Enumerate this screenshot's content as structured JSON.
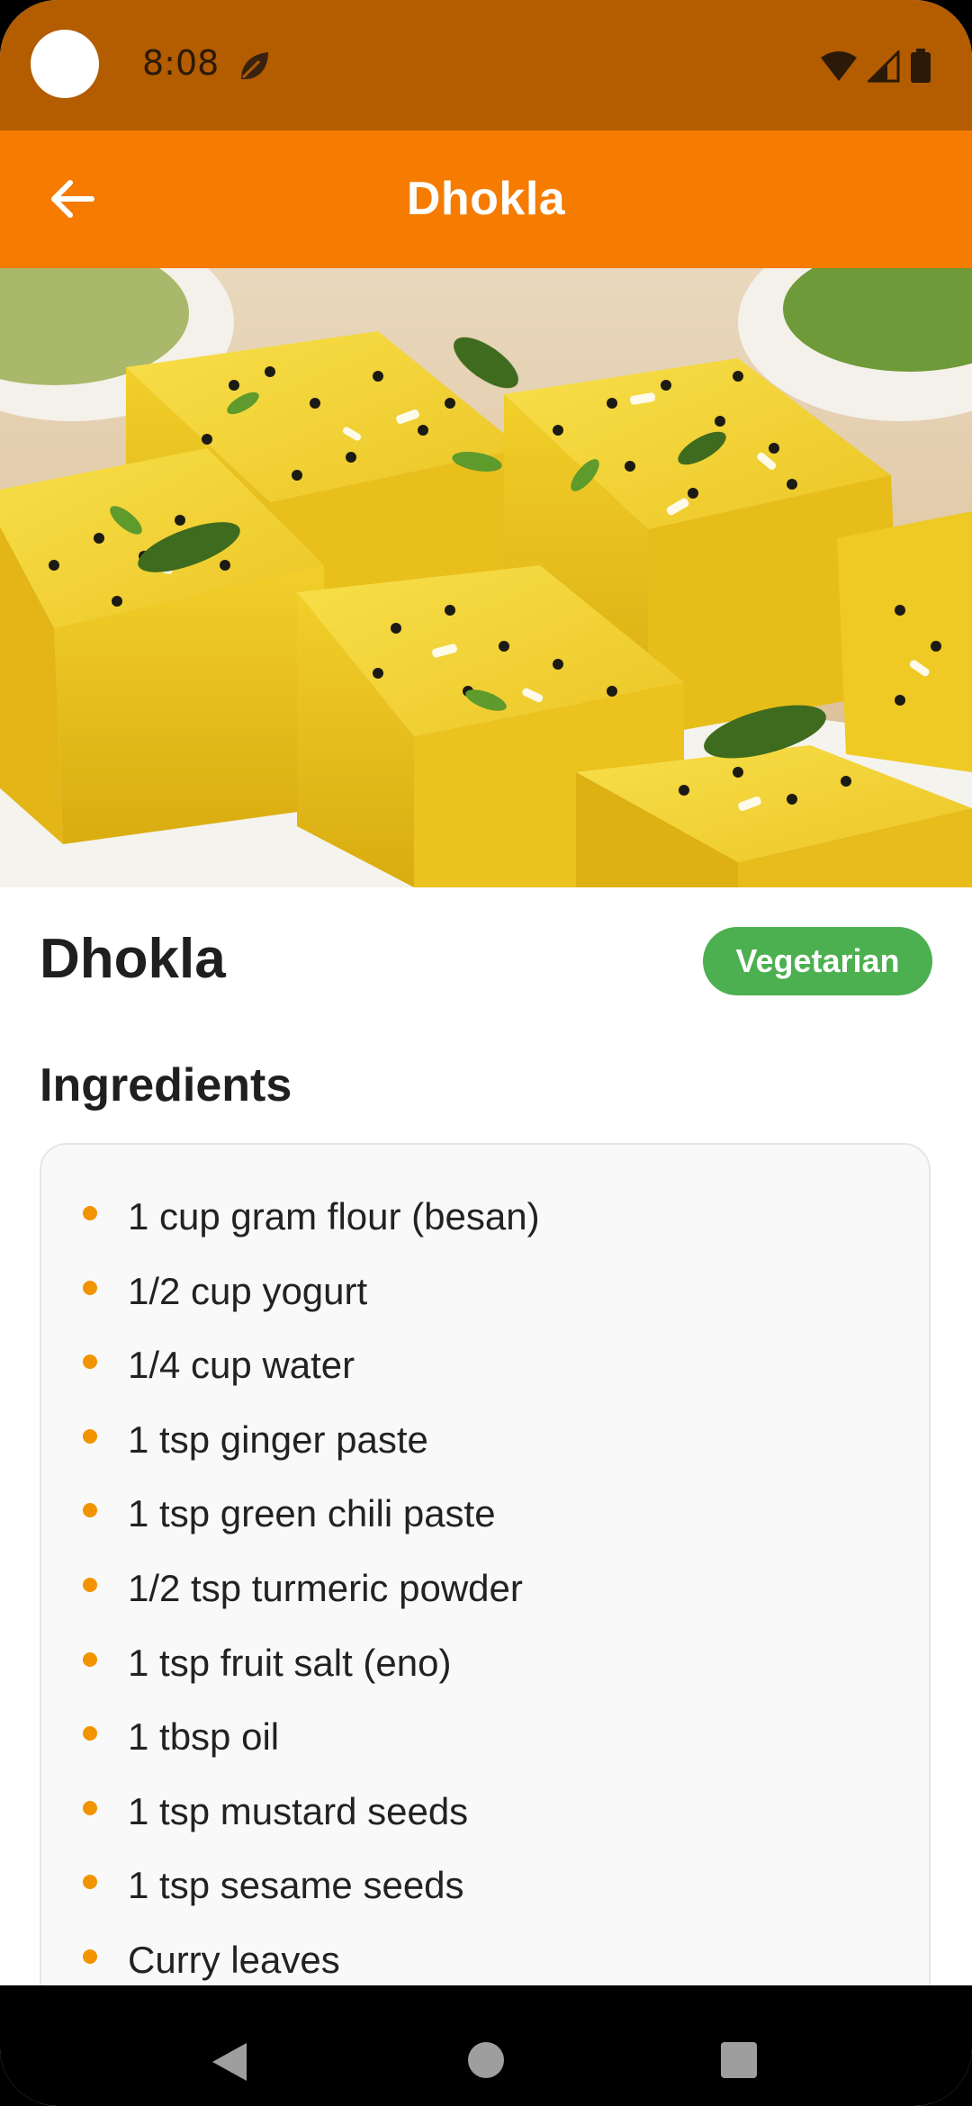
{
  "status_bar": {
    "time": "8:08",
    "icons": [
      "leaf-icon",
      "wifi-icon",
      "signal-icon",
      "battery-icon"
    ]
  },
  "app_bar": {
    "title": "Dhokla",
    "back_icon": "arrow-left-icon"
  },
  "hero": {
    "image": "dhokla-photo"
  },
  "recipe": {
    "name": "Dhokla",
    "badge": "Vegetarian"
  },
  "ingredients": {
    "heading": "Ingredients",
    "items": [
      "1 cup gram flour (besan)",
      "1/2 cup yogurt",
      "1/4 cup water",
      "1 tsp ginger paste",
      "1 tsp green chili paste",
      "1/2 tsp turmeric powder",
      "1 tsp fruit salt (eno)",
      "1 tbsp oil",
      "1 tsp mustard seeds",
      "1 tsp sesame seeds",
      "Curry leaves"
    ]
  },
  "nav_bar": {
    "buttons": [
      "back-triangle-icon",
      "home-circle-icon",
      "recents-square-icon"
    ]
  },
  "colors": {
    "status_bar": "#B35C00",
    "app_bar": "#F57C00",
    "badge": "#4CAF50",
    "bullet": "#F29400"
  }
}
